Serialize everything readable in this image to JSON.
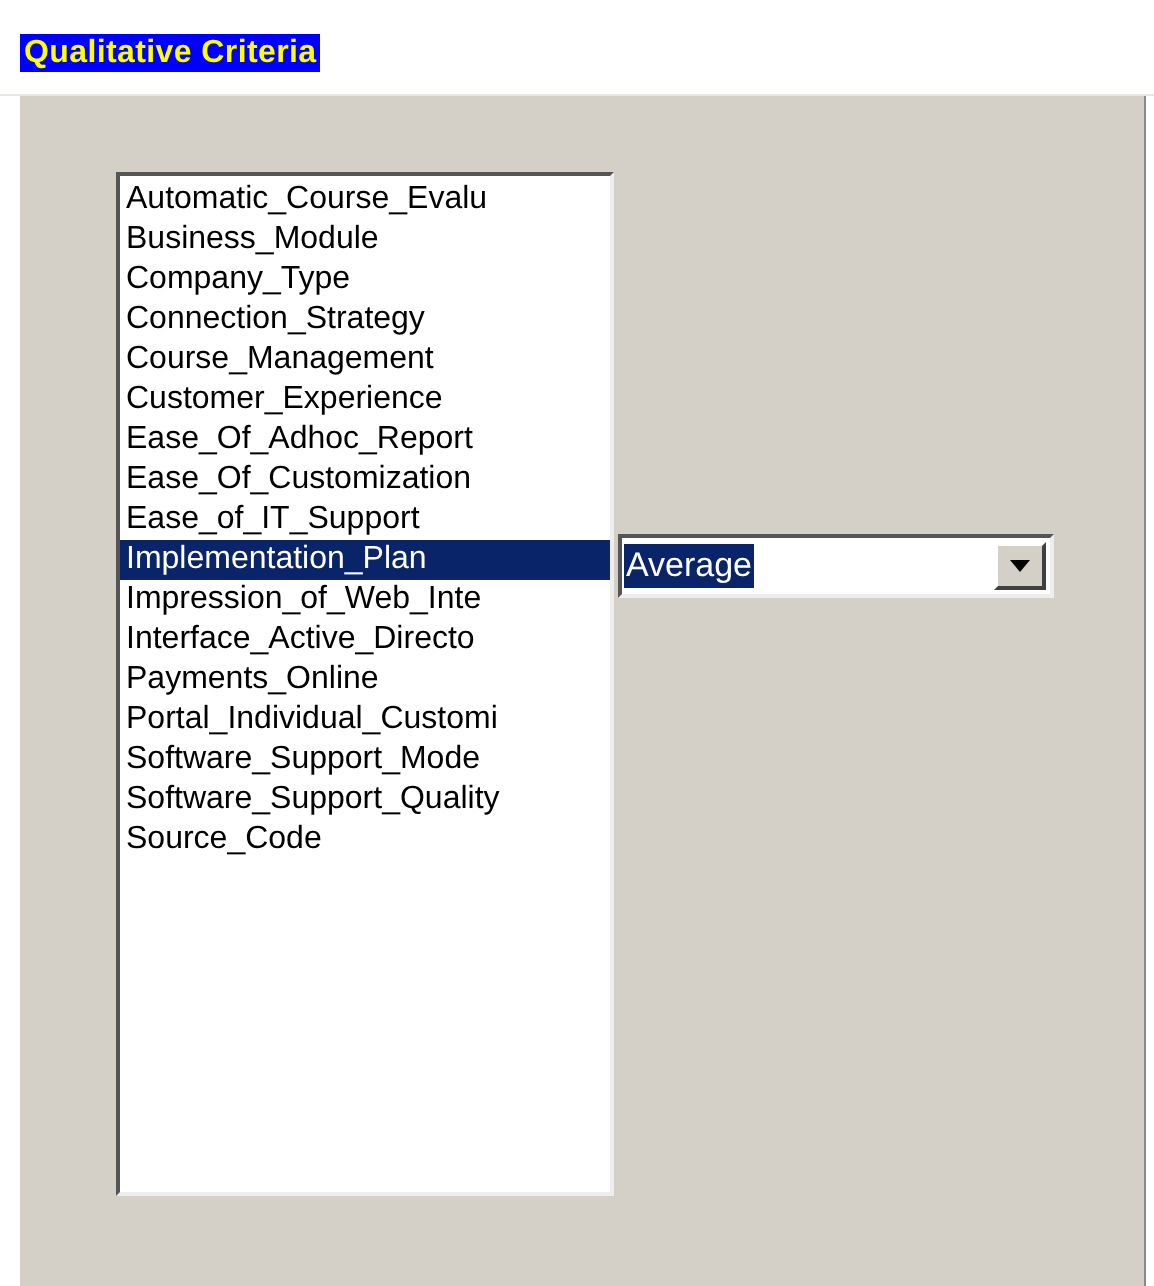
{
  "title": "Qualitative Criteria",
  "criteria": [
    {
      "label": "Automatic_Course_Evalu",
      "selected": false
    },
    {
      "label": "Business_Module",
      "selected": false
    },
    {
      "label": "Company_Type",
      "selected": false
    },
    {
      "label": "Connection_Strategy",
      "selected": false
    },
    {
      "label": "Course_Management",
      "selected": false
    },
    {
      "label": "Customer_Experience",
      "selected": false
    },
    {
      "label": "Ease_Of_Adhoc_Report",
      "selected": false
    },
    {
      "label": "Ease_Of_Customization",
      "selected": false
    },
    {
      "label": "Ease_of_IT_Support",
      "selected": false
    },
    {
      "label": "Implementation_Plan",
      "selected": true
    },
    {
      "label": "Impression_of_Web_Inte",
      "selected": false
    },
    {
      "label": "Interface_Active_Directo",
      "selected": false
    },
    {
      "label": "Payments_Online",
      "selected": false
    },
    {
      "label": "Portal_Individual_Customi",
      "selected": false
    },
    {
      "label": "Software_Support_Mode",
      "selected": false
    },
    {
      "label": "Software_Support_Quality",
      "selected": false
    },
    {
      "label": "Source_Code",
      "selected": false
    }
  ],
  "rating": {
    "value": "Average"
  }
}
